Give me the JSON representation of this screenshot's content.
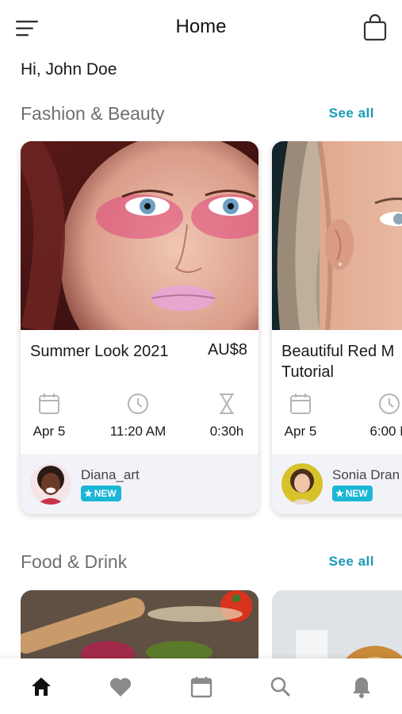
{
  "header": {
    "title": "Home",
    "menu_icon": "menu-icon",
    "bag_icon": "shopping-bag-icon"
  },
  "greeting": "Hi, John Doe",
  "sections": [
    {
      "title": "Fashion & Beauty",
      "see_all": "See all",
      "cards": [
        {
          "title": "Summer Look 2021",
          "price": "AU$8",
          "date": "Apr 5",
          "time": "11:20 AM",
          "duration": "0:30h",
          "author": "Diana_art",
          "badge": "NEW"
        },
        {
          "title": "Beautiful Red M Tutorial",
          "price": "",
          "date": "Apr 5",
          "time": "6:00 P",
          "duration": "",
          "author": "Sonia Dran",
          "badge": "NEW"
        }
      ]
    },
    {
      "title": "Food & Drink",
      "see_all": "See all"
    }
  ],
  "tabbar": {
    "items": [
      "home-icon",
      "heart-icon",
      "calendar-icon",
      "search-icon",
      "bell-icon"
    ],
    "active": "home-icon"
  },
  "colors": {
    "accent": "#1b9ab7",
    "badge": "#1ab6d6",
    "author_bar": "#f2f3f8",
    "section_title": "#6f6f6f"
  }
}
